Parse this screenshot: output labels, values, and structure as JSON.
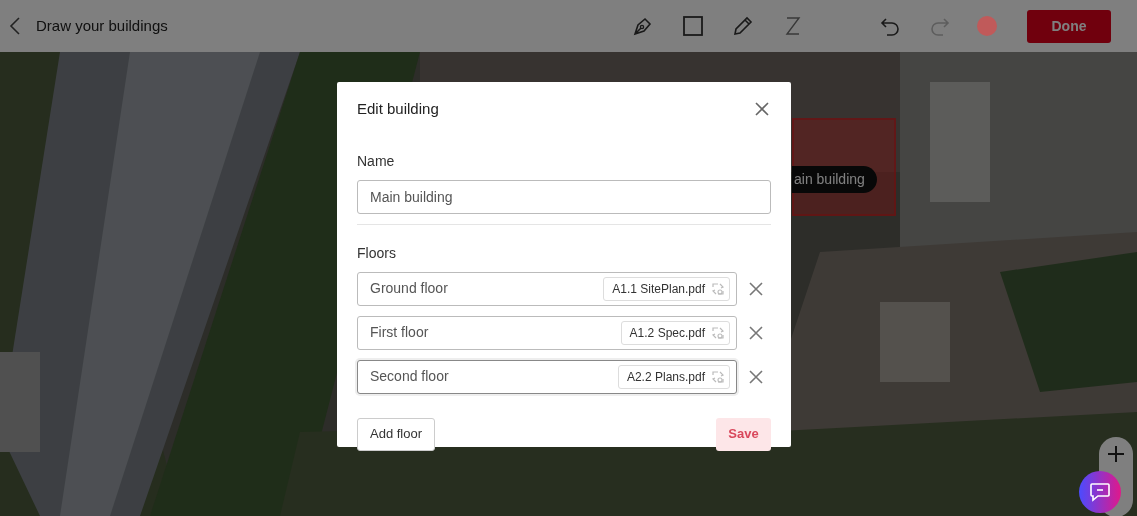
{
  "top_bar": {
    "title": "Draw your buildings",
    "tools": [
      {
        "kind": "pen",
        "disabled": false
      },
      {
        "kind": "rectangle",
        "disabled": false
      },
      {
        "kind": "pencil",
        "disabled": false
      },
      {
        "kind": "freehand",
        "disabled": false
      },
      {
        "kind": "undo",
        "disabled": false
      },
      {
        "kind": "redo",
        "disabled": true
      }
    ],
    "color_swatch": {
      "color": "#c05a5a"
    },
    "done_button": "Done"
  },
  "map": {
    "building_label": "ain building"
  },
  "modal": {
    "title": "Edit building",
    "name_label": "Name",
    "name_value": "Main building",
    "floors_label": "Floors",
    "floors": [
      {
        "value": "Ground floor",
        "file": "A1.1 SitePlan.pdf",
        "focused": false
      },
      {
        "value": "First floor",
        "file": "A1.2 Spec.pdf",
        "focused": false
      },
      {
        "value": "Second floor",
        "file": "A2.2 Plans.pdf",
        "focused": true
      }
    ],
    "add_button": "Add floor",
    "save_button": {
      "label": "Save",
      "disabled": true
    }
  }
}
